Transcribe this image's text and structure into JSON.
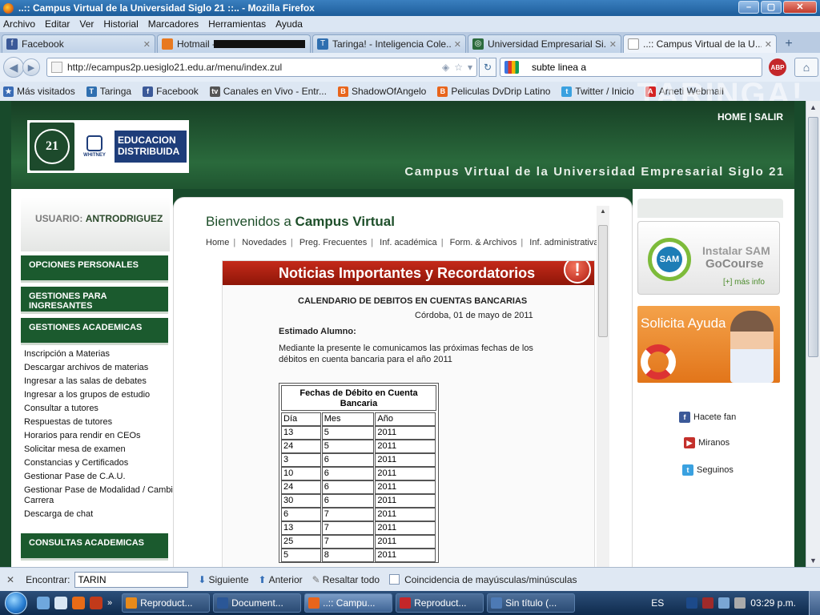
{
  "window": {
    "title": "..:: Campus Virtual de la Universidad Siglo 21 ::.. - Mozilla Firefox"
  },
  "menu": [
    "Archivo",
    "Editar",
    "Ver",
    "Historial",
    "Marcadores",
    "Herramientas",
    "Ayuda"
  ],
  "tabs": [
    {
      "label": "Facebook",
      "icon_color": "#3b5998",
      "icon": "facebook-icon"
    },
    {
      "label": "Hotmail - ",
      "icon_color": "#e8791f",
      "icon": "hotmail-icon"
    },
    {
      "label": "Taringa! - Inteligencia Cole...",
      "icon_color": "#2f6fb0",
      "icon": "taringa-icon"
    },
    {
      "label": "Universidad Empresarial Si...",
      "icon_color": "#2c6b3d",
      "icon": "university-icon"
    },
    {
      "label": "..:: Campus Virtual de la U...",
      "icon_color": "#ffffff",
      "icon": "page-icon",
      "active": true
    }
  ],
  "nav": {
    "url": "http://ecampus2p.uesiglo21.edu.ar/menu/index.zul",
    "search_value": "subte linea a",
    "abp_label": "ABP"
  },
  "bookmarks": [
    {
      "label": "Más visitados",
      "color": "#3a6cb5"
    },
    {
      "label": "Taringa",
      "color": "#2f6fb0"
    },
    {
      "label": "Facebook",
      "color": "#3b5998"
    },
    {
      "label": "Canales en Vivo - Entr...",
      "color": "#555555"
    },
    {
      "label": "ShadowOfAngelo",
      "color": "#e8651c"
    },
    {
      "label": "Peliculas DvDrip Latino",
      "color": "#e8651c"
    },
    {
      "label": "Twitter / Inicio",
      "color": "#3aa1e0"
    },
    {
      "label": "Arneti Webmail",
      "color": "#d42222"
    }
  ],
  "taringa_watermark": "TARINGA!",
  "site": {
    "home_salir": "HOME | SALIR",
    "campus_title": "Campus Virtual de la Universidad Empresarial Siglo 21",
    "logo": {
      "ue": "21",
      "whitney": "WHITNEY",
      "edu": "EDUCACION DISTRIBUIDA"
    },
    "user_label": "USUARIO:",
    "user_name": "ANTRODRIGUEZ",
    "groups": [
      "OPCIONES PERSONALES",
      "GESTIONES PARA INGRESANTES",
      "GESTIONES ACADEMICAS",
      "CONSULTAS ACADEMICAS"
    ],
    "academic_links": [
      "Inscripción a Materias",
      "Descargar archivos de materias",
      "Ingresar a las salas de debates",
      "Ingresar a los grupos de estudio",
      "Consultar a tutores",
      "Respuestas de tutores",
      "Horarios para rendir en CEOs",
      "Solicitar mesa de examen",
      "Constancias y Certificados",
      "Gestionar Pase de C.A.U.",
      "Gestionar Pase de Modalidad / Cambi Carrera",
      "Descarga de chat"
    ],
    "welcome_prefix": "Bienvenidos a",
    "welcome_bold": "Campus Virtual",
    "top_links": [
      "Home",
      "Novedades",
      "Preg. Frecuentes",
      "Inf. académica",
      "Form. & Archivos",
      "Inf. administrativa"
    ],
    "news_banner": "Noticias Importantes y Recordatorios",
    "cal_title": "CALENDARIO DE DEBITOS EN CUENTAS BANCARIAS",
    "cal_date": "Córdoba, 01 de mayo de 2011",
    "cal_greet": "Estimado Alumno:",
    "cal_msg": "Mediante la presente le comunicamos las próximas fechas de los débitos en cuenta bancaria para el año 2011",
    "table_title": "Fechas de Débito en Cuenta Bancaria",
    "table_headers": [
      "Día",
      "Mes",
      "Año"
    ],
    "table_rows": [
      [
        "13",
        "5",
        "2011"
      ],
      [
        "24",
        "5",
        "2011"
      ],
      [
        "3",
        "6",
        "2011"
      ],
      [
        "10",
        "6",
        "2011"
      ],
      [
        "24",
        "6",
        "2011"
      ],
      [
        "30",
        "6",
        "2011"
      ],
      [
        "6",
        "7",
        "2011"
      ],
      [
        "13",
        "7",
        "2011"
      ],
      [
        "25",
        "7",
        "2011"
      ],
      [
        "5",
        "8",
        "2011"
      ]
    ],
    "sam": {
      "line1": "Instalar SAM",
      "line2": "GoCourse",
      "info": "[+] más info",
      "logo": "SAM"
    },
    "ayuda": "Solicita Ayuda",
    "social": [
      {
        "label": "Hacete fan",
        "icon": "facebook-icon",
        "color": "#3b5998"
      },
      {
        "label": "Miranos",
        "icon": "youtube-icon",
        "color": "#c4302b"
      },
      {
        "label": "Seguinos",
        "icon": "twitter-icon",
        "color": "#3aa1e0"
      }
    ]
  },
  "findbar": {
    "label": "Encontrar:",
    "value": "TARIN",
    "next": "Siguiente",
    "prev": "Anterior",
    "highlight": "Resaltar todo",
    "match_case": "Coincidencia de mayúsculas/minúsculas"
  },
  "taskbar": {
    "buttons": [
      {
        "label": "Reproduct...",
        "color": "#e88a1a"
      },
      {
        "label": "Document...",
        "color": "#2b5797"
      },
      {
        "label": "..:: Campu...",
        "color": "#e8651c",
        "active": true
      },
      {
        "label": "Reproduct...",
        "color": "#c4272a"
      },
      {
        "label": "Sin título (...",
        "color": "#4d7ab5"
      }
    ],
    "lang": "ES",
    "clock": "03:29 p.m."
  }
}
